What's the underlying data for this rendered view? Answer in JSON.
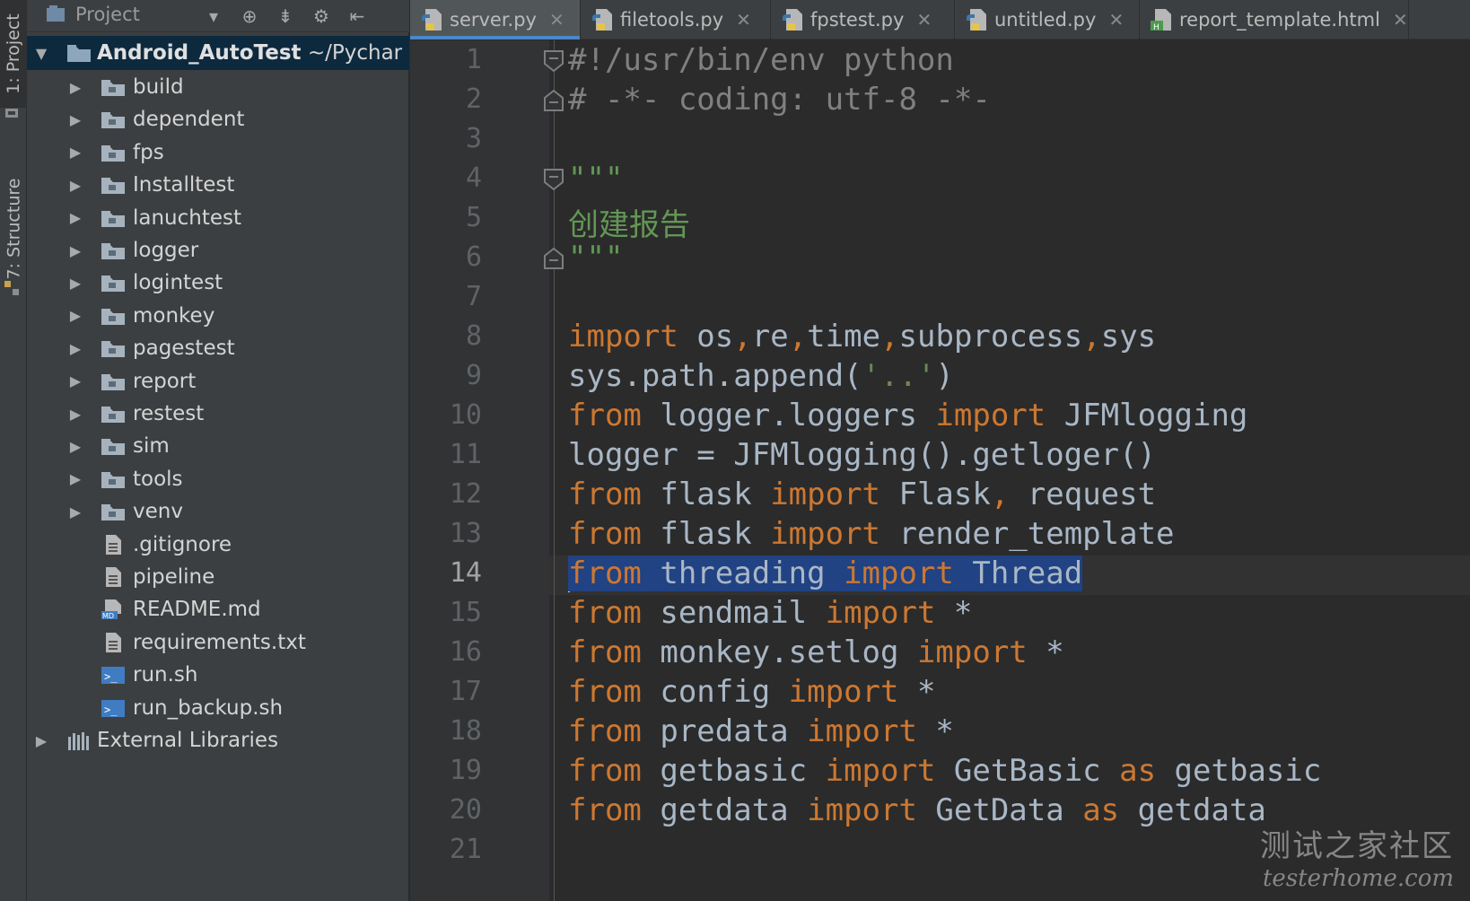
{
  "tool_strip": {
    "project_tab": "1: Project",
    "structure_tab": "7: Structure"
  },
  "project_panel": {
    "title": "Project",
    "root": "Android_AutoTest",
    "root_path": "~/Pychar",
    "items": [
      {
        "label": "build",
        "type": "folder"
      },
      {
        "label": "dependent",
        "type": "folder"
      },
      {
        "label": "fps",
        "type": "folder"
      },
      {
        "label": "Installtest",
        "type": "folder"
      },
      {
        "label": "lanuchtest",
        "type": "folder"
      },
      {
        "label": "logger",
        "type": "folder"
      },
      {
        "label": "logintest",
        "type": "folder"
      },
      {
        "label": "monkey",
        "type": "folder"
      },
      {
        "label": "pagestest",
        "type": "folder"
      },
      {
        "label": "report",
        "type": "folder"
      },
      {
        "label": "restest",
        "type": "folder"
      },
      {
        "label": "sim",
        "type": "folder"
      },
      {
        "label": "tools",
        "type": "folder"
      },
      {
        "label": "venv",
        "type": "folder"
      },
      {
        "label": ".gitignore",
        "type": "text-file"
      },
      {
        "label": "pipeline",
        "type": "text-file"
      },
      {
        "label": "README.md",
        "type": "markdown-file"
      },
      {
        "label": "requirements.txt",
        "type": "text-file"
      },
      {
        "label": "run.sh",
        "type": "shell-file"
      },
      {
        "label": "run_backup.sh",
        "type": "shell-file"
      }
    ],
    "external_libraries": "External Libraries"
  },
  "tabs": [
    {
      "label": "server.py",
      "icon": "python-file-icon",
      "active": true
    },
    {
      "label": "filetools.py",
      "icon": "python-file-icon",
      "active": false
    },
    {
      "label": "fpstest.py",
      "icon": "python-file-icon",
      "active": false
    },
    {
      "label": "untitled.py",
      "icon": "python-file-icon",
      "active": false
    },
    {
      "label": "report_template.html",
      "icon": "html-file-icon",
      "active": false
    }
  ],
  "editor": {
    "current_line": 14,
    "line_numbers": [
      "1",
      "2",
      "3",
      "4",
      "5",
      "6",
      "7",
      "8",
      "9",
      "10",
      "11",
      "12",
      "13",
      "14",
      "15",
      "16",
      "17",
      "18",
      "19",
      "20",
      "21"
    ],
    "lines": [
      {
        "n": 1,
        "tokens": [
          [
            "cmt",
            "#!/usr/bin/env python"
          ]
        ]
      },
      {
        "n": 2,
        "tokens": [
          [
            "cmt",
            "# -*- coding: utf-8 -*-"
          ]
        ]
      },
      {
        "n": 3,
        "tokens": []
      },
      {
        "n": 4,
        "tokens": [
          [
            "doc",
            "\"\"\""
          ]
        ]
      },
      {
        "n": 5,
        "tokens": [
          [
            "doc",
            "创建报告"
          ]
        ]
      },
      {
        "n": 6,
        "tokens": [
          [
            "doc",
            "\"\"\""
          ]
        ]
      },
      {
        "n": 7,
        "tokens": []
      },
      {
        "n": 8,
        "tokens": [
          [
            "kw",
            "import"
          ],
          [
            "txt",
            " os"
          ],
          [
            "kw",
            ","
          ],
          [
            "txt",
            "re"
          ],
          [
            "kw",
            ","
          ],
          [
            "txt",
            "time"
          ],
          [
            "kw",
            ","
          ],
          [
            "txt",
            "subprocess"
          ],
          [
            "kw",
            ","
          ],
          [
            "txt",
            "sys"
          ]
        ]
      },
      {
        "n": 9,
        "tokens": [
          [
            "txt",
            "sys.path.append("
          ],
          [
            "str",
            "'..'"
          ],
          [
            "txt",
            ")"
          ]
        ]
      },
      {
        "n": 10,
        "tokens": [
          [
            "kw",
            "from"
          ],
          [
            "txt",
            " logger.loggers "
          ],
          [
            "kw",
            "import"
          ],
          [
            "txt",
            " JFMlogging"
          ]
        ]
      },
      {
        "n": 11,
        "tokens": [
          [
            "txt",
            "logger = JFMlogging().getloger()"
          ]
        ]
      },
      {
        "n": 12,
        "tokens": [
          [
            "kw",
            "from"
          ],
          [
            "txt",
            " flask "
          ],
          [
            "kw",
            "import"
          ],
          [
            "txt",
            " Flask"
          ],
          [
            "kw",
            ","
          ],
          [
            "txt",
            " request"
          ]
        ]
      },
      {
        "n": 13,
        "tokens": [
          [
            "kw",
            "from"
          ],
          [
            "txt",
            " flask "
          ],
          [
            "kw",
            "import"
          ],
          [
            "txt",
            " render_template"
          ]
        ]
      },
      {
        "n": 14,
        "tokens": [
          [
            "kw",
            "from"
          ],
          [
            "txt",
            " threading "
          ],
          [
            "kw",
            "import"
          ],
          [
            "txt",
            " Thread"
          ]
        ],
        "selected": true
      },
      {
        "n": 15,
        "tokens": [
          [
            "kw",
            "from"
          ],
          [
            "txt",
            " sendmail "
          ],
          [
            "kw",
            "import"
          ],
          [
            "txt",
            " *"
          ]
        ]
      },
      {
        "n": 16,
        "tokens": [
          [
            "kw",
            "from"
          ],
          [
            "txt",
            " monkey.setlog "
          ],
          [
            "kw",
            "import"
          ],
          [
            "txt",
            " *"
          ]
        ]
      },
      {
        "n": 17,
        "tokens": [
          [
            "kw",
            "from"
          ],
          [
            "txt",
            " config "
          ],
          [
            "kw",
            "import"
          ],
          [
            "txt",
            " *"
          ]
        ]
      },
      {
        "n": 18,
        "tokens": [
          [
            "kw",
            "from"
          ],
          [
            "txt",
            " predata "
          ],
          [
            "kw",
            "import"
          ],
          [
            "txt",
            " *"
          ]
        ]
      },
      {
        "n": 19,
        "tokens": [
          [
            "kw",
            "from"
          ],
          [
            "txt",
            " getbasic "
          ],
          [
            "kw",
            "import"
          ],
          [
            "txt",
            " GetBasic "
          ],
          [
            "kw",
            "as"
          ],
          [
            "txt",
            " getbasic"
          ]
        ]
      },
      {
        "n": 20,
        "tokens": [
          [
            "kw",
            "from"
          ],
          [
            "txt",
            " getdata "
          ],
          [
            "kw",
            "import"
          ],
          [
            "txt",
            " GetData "
          ],
          [
            "kw",
            "as"
          ],
          [
            "txt",
            " getdata"
          ]
        ]
      },
      {
        "n": 21,
        "tokens": []
      }
    ]
  },
  "watermark": {
    "line1": "测试之家社区",
    "line2": "testerhome.com"
  },
  "colors": {
    "keyword": "#cc7832",
    "plain": "#a9b7c6",
    "comment": "#808080",
    "docstring": "#629755",
    "string": "#6a8759",
    "selection": "#214283",
    "tab_underline": "#4a88c7"
  }
}
